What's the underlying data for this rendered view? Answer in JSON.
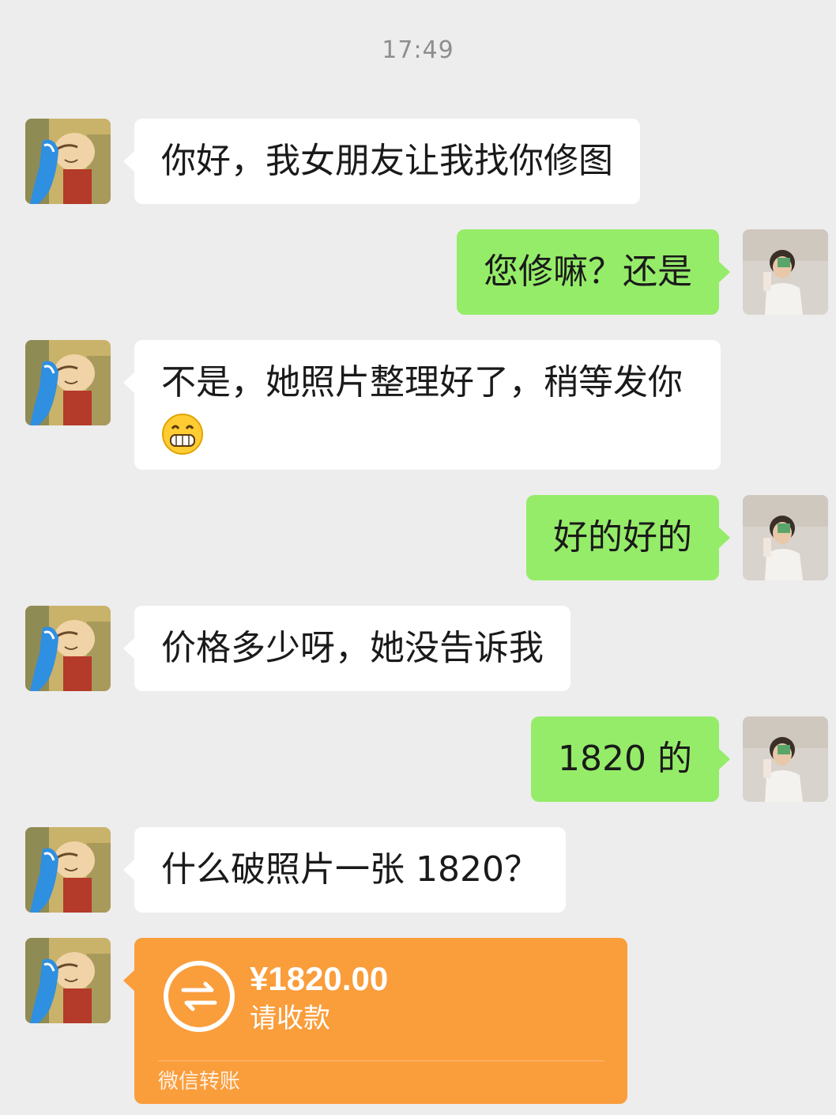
{
  "timestamp": "17:49",
  "messages": [
    {
      "side": "left",
      "text": "你好，我女朋友让我找你修图"
    },
    {
      "side": "right",
      "text": "您修嘛？还是"
    },
    {
      "side": "left",
      "text": "不是，她照片整理好了，稍等发你",
      "emoji": "grinning-face-emoji"
    },
    {
      "side": "right",
      "text": "好的好的"
    },
    {
      "side": "left",
      "text": "价格多少呀，她没告诉我"
    },
    {
      "side": "right",
      "text": "1820 的"
    },
    {
      "side": "left",
      "text": "什么破照片一张 1820？"
    }
  ],
  "transfer": {
    "amount": "¥1820.00",
    "status": "请收款",
    "label": "微信转账",
    "icon": "transfer-arrows-icon",
    "color": "#fa9d3b"
  },
  "colors": {
    "background": "#ededed",
    "incoming_bubble": "#ffffff",
    "outgoing_bubble": "#95ec69",
    "timestamp_text": "#8e8e8e"
  }
}
